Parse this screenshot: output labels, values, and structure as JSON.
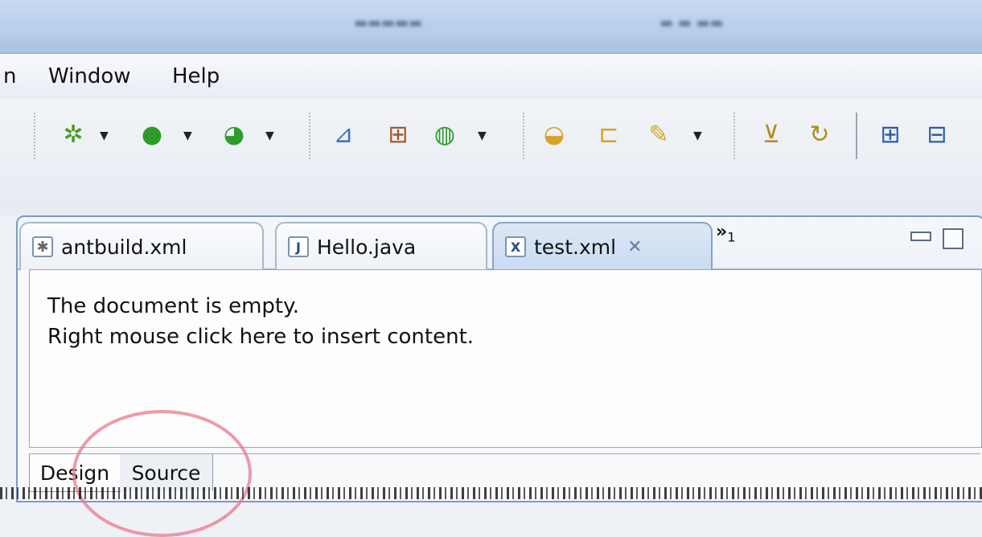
{
  "menu": {
    "items": [
      "n",
      "Window",
      "Help"
    ]
  },
  "toolbar": {
    "icons": [
      "debug-icon",
      "run-icon",
      "external-tools-icon",
      "new-project-icon",
      "new-package-icon",
      "new-class-icon",
      "open-type-icon",
      "open-folder-icon",
      "pen-icon",
      "build-icon",
      "refresh-icon",
      "expand-icon",
      "collapse-icon"
    ]
  },
  "editor": {
    "tabs": [
      {
        "label": "antbuild.xml",
        "icon": "ant-file-icon"
      },
      {
        "label": "Hello.java",
        "icon": "java-file-icon",
        "icon_text": "J"
      },
      {
        "label": "test.xml",
        "icon": "xml-file-icon",
        "icon_text": "X",
        "active": true
      }
    ],
    "overflow": {
      "symbol": "»",
      "count": "1"
    },
    "content": {
      "line1": "The document is empty.",
      "line2": "Right mouse click here to insert content."
    },
    "bottom_tabs": {
      "design": "Design",
      "source": "Source"
    }
  },
  "colors": {
    "annotation_circle": "#e8788c",
    "active_tab": "#c9dcf3",
    "frame_border": "#7c9ac4"
  }
}
